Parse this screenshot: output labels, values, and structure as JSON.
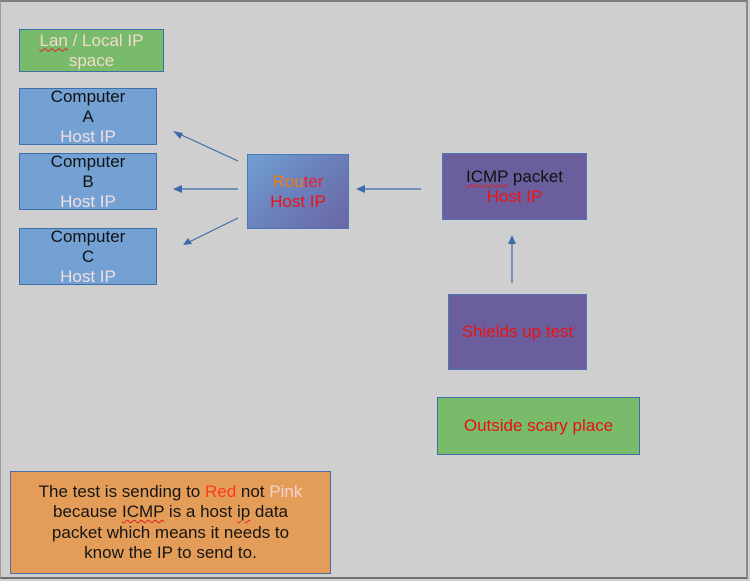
{
  "diagram": {
    "lan_label": {
      "part1": "Lan",
      "part2": " / Local IP",
      "line2": "space"
    },
    "computers": [
      {
        "name": "Computer",
        "letter": "A",
        "ip": "Host IP"
      },
      {
        "name": "Computer",
        "letter": "B",
        "ip": "Host IP"
      },
      {
        "name": "Computer",
        "letter": "C",
        "ip": "Host IP"
      }
    ],
    "router": {
      "name_part1": "Rou",
      "name_part2": "ter",
      "ip": "Host IP"
    },
    "icmp": {
      "title_part1": "ICMP",
      "title_part2": " packet",
      "ip": "Host IP"
    },
    "shields": {
      "label": "Shields up test"
    },
    "outside": {
      "label": "Outside scary place"
    },
    "note": {
      "l1a": "The test is sending to ",
      "l1red": "Red",
      "l1b": " not ",
      "l1pink": "Pink",
      "l2a": "because ",
      "l2icmp": "ICMP",
      "l2b": " is a host ",
      "l2ip": "ip",
      "l2c": " data",
      "l3": "packet which means it needs to",
      "l4": "know the IP to send to."
    },
    "colors": {
      "arrow": "#3d6aa8",
      "green_box": "#78bb6a",
      "blue_box": "#73a1d4",
      "purple_box": "#6a5f9c",
      "orange_box": "#e39d59",
      "host_ip_red": "#ee1111",
      "canvas": "#cfcfcf"
    },
    "arrows": [
      {
        "from": "router",
        "to": "computer-a"
      },
      {
        "from": "router",
        "to": "computer-b"
      },
      {
        "from": "router",
        "to": "computer-c"
      },
      {
        "from": "icmp-packet",
        "to": "router"
      },
      {
        "from": "shields-up-test",
        "to": "icmp-packet"
      }
    ]
  }
}
